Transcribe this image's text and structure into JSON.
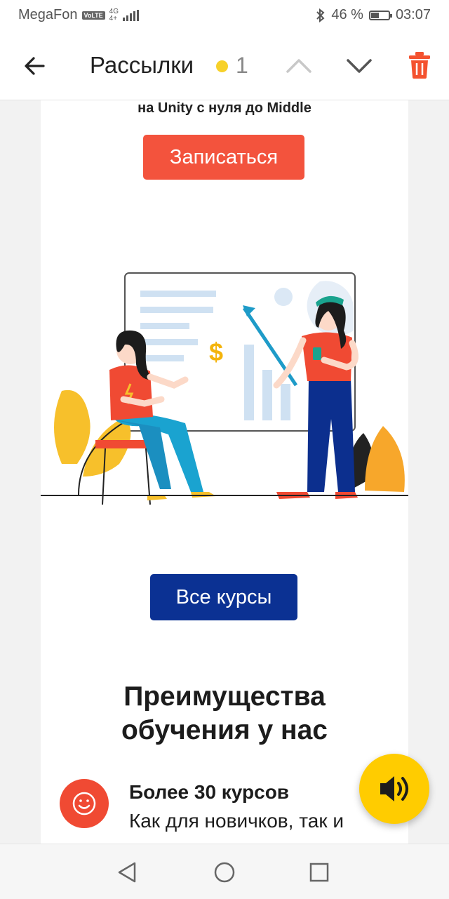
{
  "status_bar": {
    "carrier": "MegaFon",
    "volte": "VoLTE",
    "network_top": "4G",
    "network_bottom": "4+",
    "battery_percent": "46 %",
    "battery_level": 0.46,
    "time": "03:07"
  },
  "header": {
    "title": "Рассылки",
    "unread_count": "1",
    "dot_color": "#f7d12a",
    "delete_color": "#f4522f"
  },
  "email": {
    "subtitle": "на Unity с нуля до Middle",
    "signup_button": "Записаться",
    "all_courses_button": "Все курсы",
    "benefits_heading_line1": "Преимущества",
    "benefits_heading_line2": "обучения у нас",
    "feature": {
      "title": "Более 30 курсов",
      "description": "Как для новичков, так и для практикующих"
    },
    "colors": {
      "signup": "#f3533d",
      "all_courses": "#0b3193"
    }
  },
  "fab": {
    "icon": "speaker-icon",
    "color": "#ffcc00"
  },
  "nav_bar": {
    "icons": [
      "back-triangle-icon",
      "home-circle-icon",
      "recents-square-icon"
    ]
  }
}
